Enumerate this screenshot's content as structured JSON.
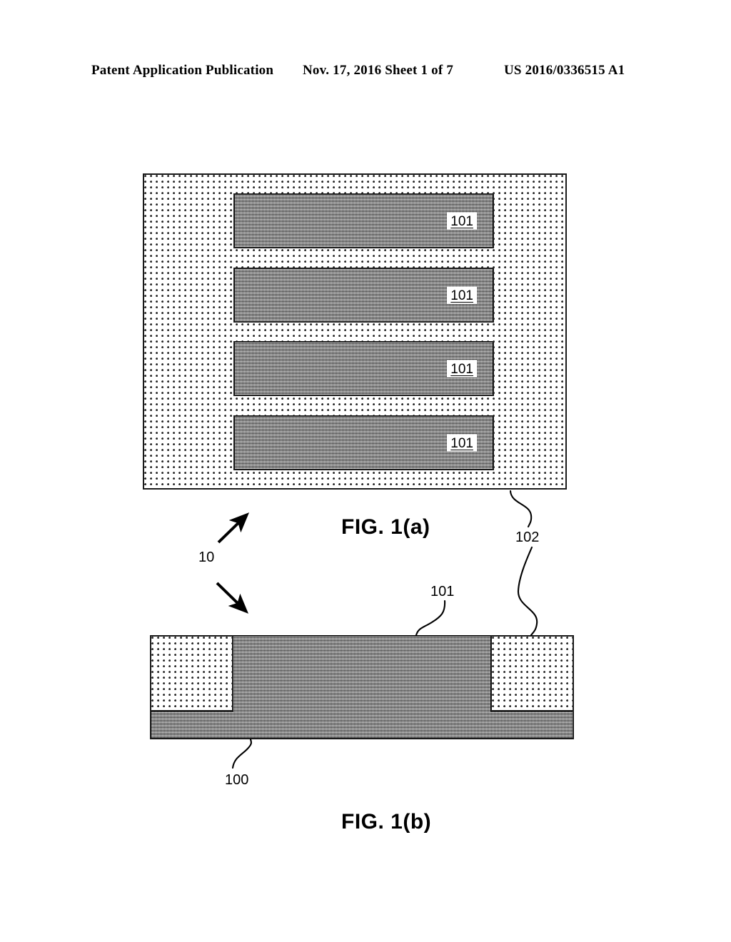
{
  "header": {
    "left": "Patent Application Publication",
    "middle": "Nov. 17, 2016  Sheet 1 of 7",
    "right": "US 2016/0336515 A1"
  },
  "figures": [
    {
      "id": "fig-1a",
      "caption": "FIG. 1(a)",
      "view": "top-plan-view",
      "background_region_label": "102",
      "fins": [
        {
          "label": "101"
        },
        {
          "label": "101"
        },
        {
          "label": "101"
        },
        {
          "label": "101"
        }
      ]
    },
    {
      "id": "fig-1b",
      "caption": "FIG. 1(b)",
      "view": "cross-section-view",
      "substrate_label": "100",
      "fin_label": "101",
      "oxide_label": "102"
    }
  ],
  "callouts": {
    "device": "10",
    "fin": "101",
    "substrate": "100",
    "oxide": "102"
  },
  "colors": {
    "ink": "#000000",
    "line": "#1a1a1a",
    "hatch_fill": "#b9b9b9",
    "stipple_fill": "#ffffff",
    "page_background": "#ffffff"
  }
}
